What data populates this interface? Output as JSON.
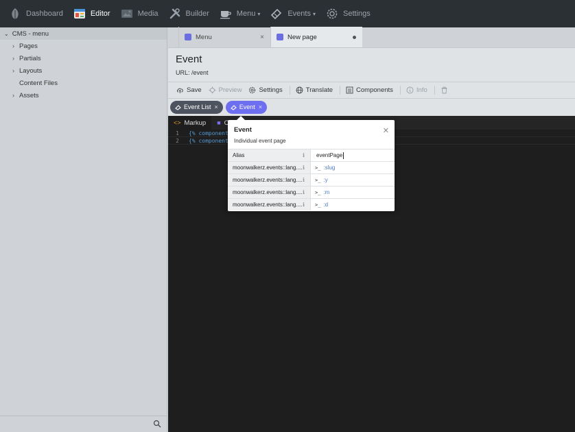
{
  "nav": {
    "items": [
      {
        "label": "Dashboard",
        "icon": "leaf-icon"
      },
      {
        "label": "Editor",
        "icon": "editor-icon"
      },
      {
        "label": "Media",
        "icon": "image-icon"
      },
      {
        "label": "Builder",
        "icon": "wrench-icon"
      },
      {
        "label": "Menu",
        "icon": "cup-icon"
      },
      {
        "label": "Events",
        "icon": "ticket-icon"
      },
      {
        "label": "Settings",
        "icon": "gear-icon"
      }
    ],
    "active": "Editor",
    "colors": {
      "bg": "#2b3034",
      "active": "#ffffff",
      "inactive": "#9aa3ab"
    }
  },
  "sidebar": {
    "title": "CMS - menu",
    "items": [
      "Pages",
      "Partials",
      "Layouts",
      "Content Files",
      "Assets"
    ]
  },
  "tabs": [
    {
      "label": "Menu"
    },
    {
      "label": "New page"
    }
  ],
  "page": {
    "title": "Event",
    "url_label": "URL:",
    "url_value": "/event"
  },
  "toolbar": {
    "save": "Save",
    "preview": "Preview",
    "settings": "Settings",
    "translate": "Translate",
    "components": "Components",
    "info": "Info"
  },
  "components": {
    "chips": [
      "Event List",
      "Event"
    ],
    "colors": {
      "dark": "#4d5460",
      "accent": "#6e6ff0"
    }
  },
  "editor": {
    "tabs": [
      "Markup",
      "C"
    ],
    "lines": [
      {
        "num": "1",
        "text": "{% component"
      },
      {
        "num": "2",
        "text": "{% component"
      }
    ]
  },
  "popover": {
    "title": "Event",
    "subtitle": "Individual event page",
    "rows": [
      {
        "key": "Alias",
        "value": "eventPage"
      },
      {
        "key": "moonwalkerz.events::lang....",
        "prompt": ">_",
        "value": ":slug"
      },
      {
        "key": "moonwalkerz.events::lang....",
        "prompt": ">_",
        "value": ":y"
      },
      {
        "key": "moonwalkerz.events::lang....",
        "prompt": ">_",
        "value": ":m"
      },
      {
        "key": "moonwalkerz.events::lang....",
        "prompt": ">_",
        "value": ":d"
      }
    ]
  }
}
